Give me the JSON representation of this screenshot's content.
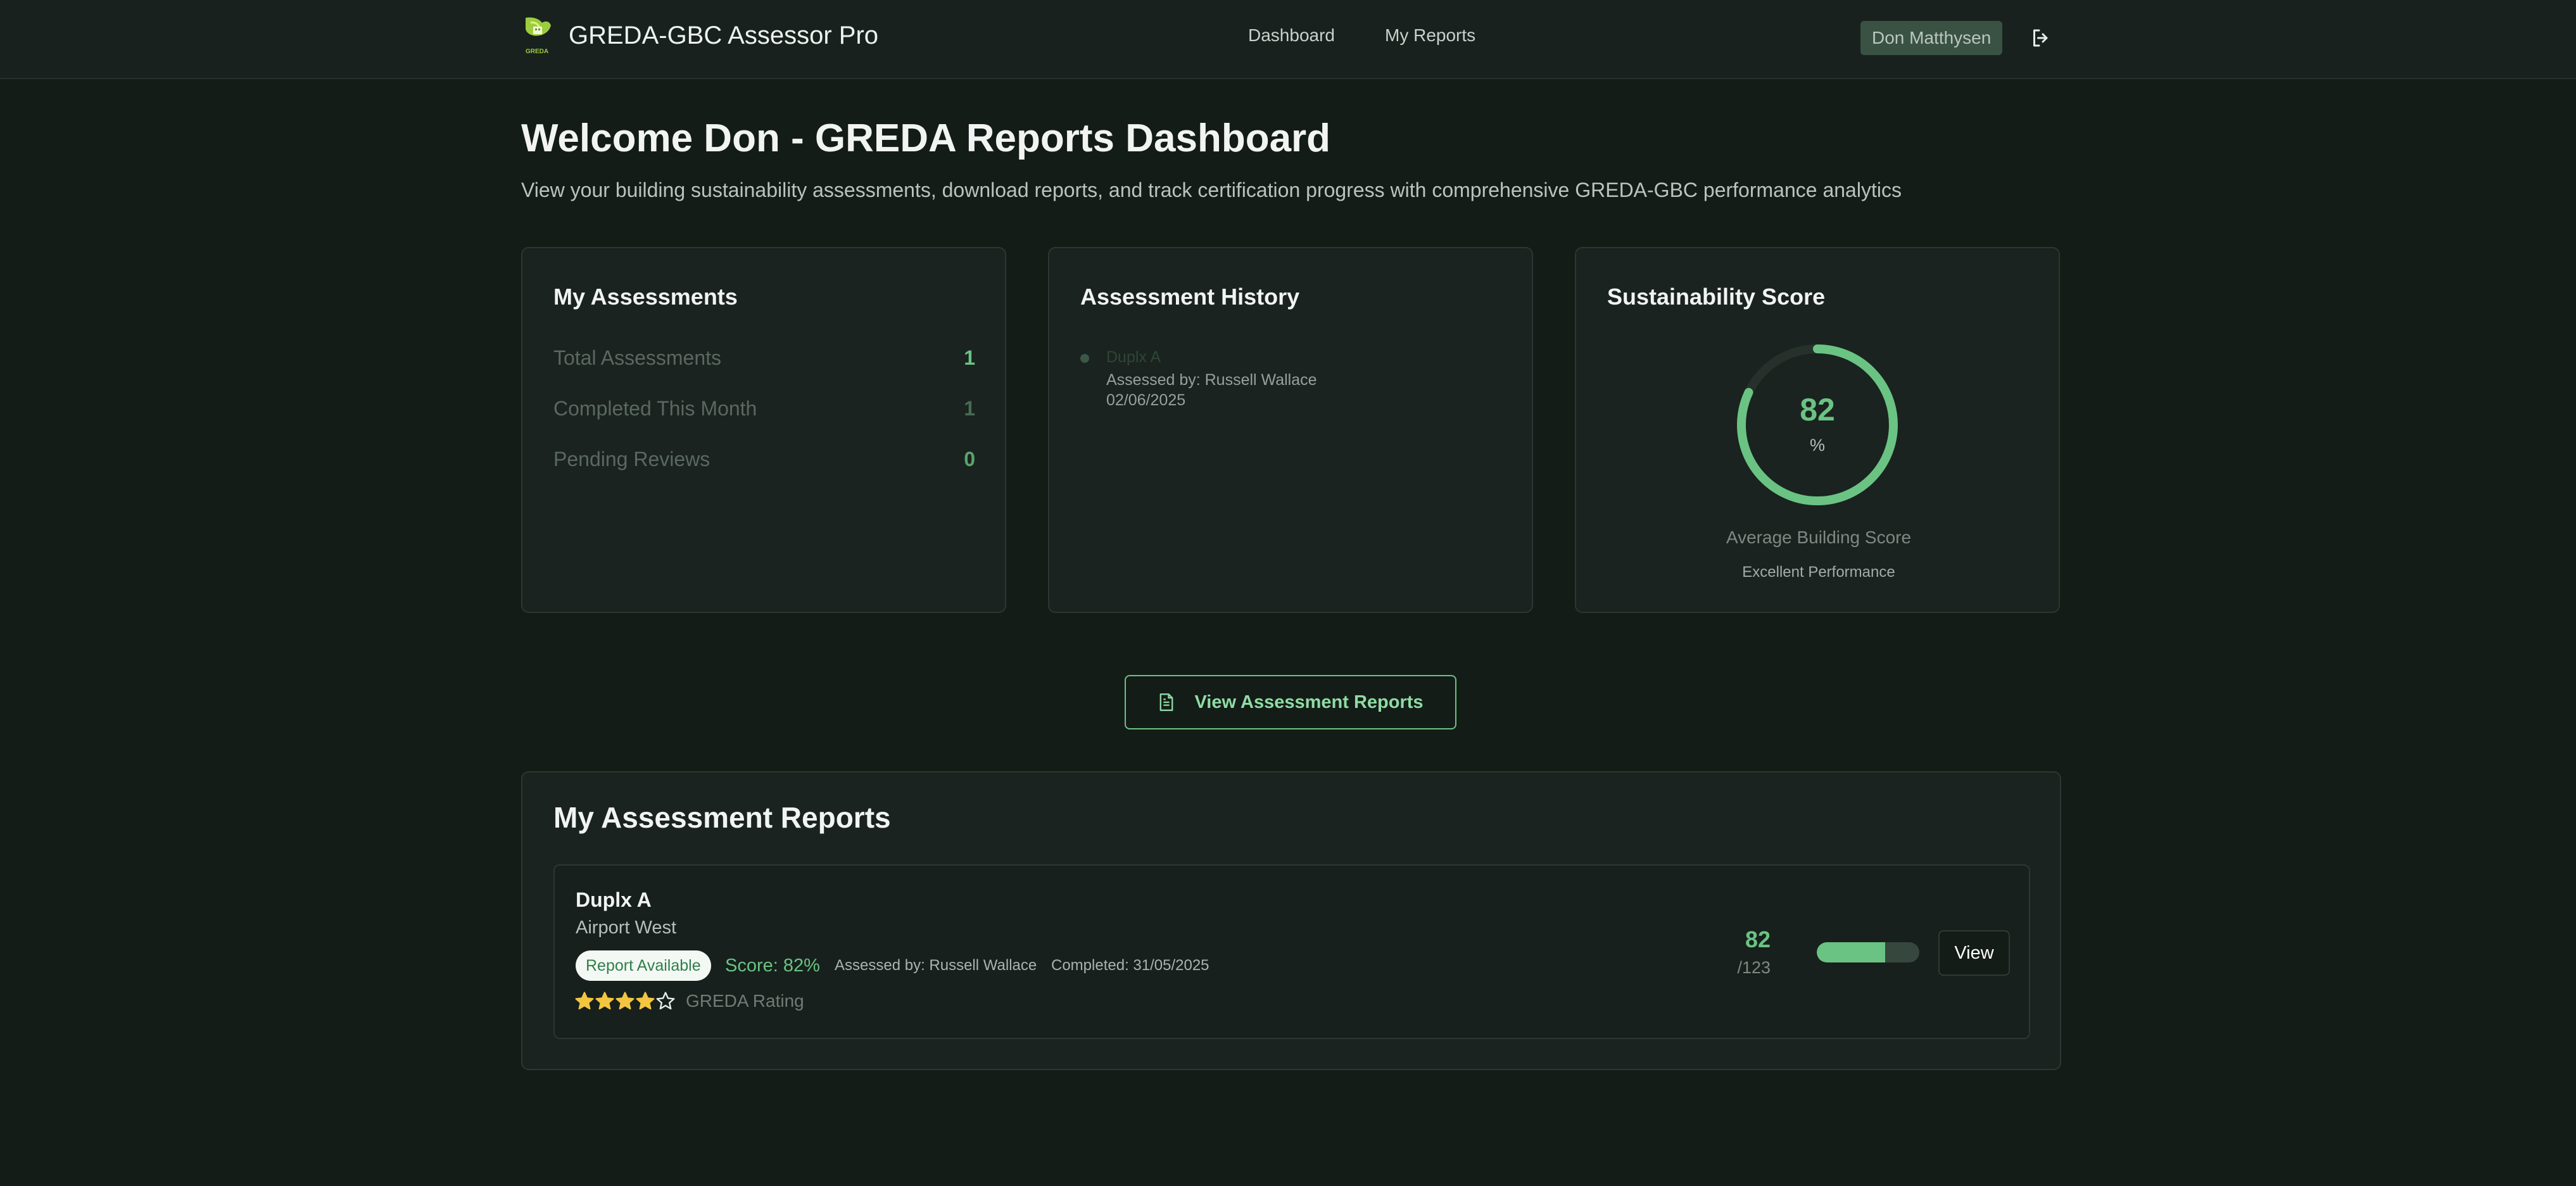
{
  "header": {
    "app_title": "GREDA-GBC Assessor Pro",
    "logo_text": "GREDA",
    "nav": [
      {
        "label": "Dashboard"
      },
      {
        "label": "My Reports"
      }
    ],
    "user_name": "Don Matthysen"
  },
  "page": {
    "title": "Welcome Don - GREDA Reports Dashboard",
    "subtitle": "View your building sustainability assessments, download reports, and track certification progress with comprehensive GREDA-GBC performance analytics"
  },
  "my_assessments": {
    "title": "My Assessments",
    "stats": [
      {
        "label": "Total Assessments",
        "value": "1"
      },
      {
        "label": "Completed This Month",
        "value": "1"
      },
      {
        "label": "Pending Reviews",
        "value": "0"
      }
    ]
  },
  "assessment_history": {
    "title": "Assessment History",
    "items": [
      {
        "name": "Duplx A",
        "assessed_by": "Assessed by: Russell Wallace",
        "date": "02/06/2025"
      }
    ]
  },
  "sustainability_score": {
    "title": "Sustainability Score",
    "value": "82",
    "unit": "%",
    "percent": 82,
    "caption": "Average Building Score",
    "performance": "Excellent Performance"
  },
  "view_reports_button": {
    "label": "View Assessment Reports"
  },
  "reports": {
    "title": "My Assessment Reports",
    "items": [
      {
        "name": "Duplx A",
        "location": "Airport West",
        "badge": "Report Available",
        "score_text": "Score: 82%",
        "assessed_by": "Assessed by: Russell Wallace",
        "completed": "Completed: 31/05/2025",
        "stars_filled": 4,
        "stars_total": 5,
        "rating_label": "GREDA Rating",
        "points": "82",
        "points_max": "/123",
        "progress_fraction": 0.667,
        "view_label": "View"
      }
    ]
  },
  "colors": {
    "background": "#141c18",
    "card": "#1a231f",
    "accent": "#6ac383",
    "star": "#f3c641"
  }
}
